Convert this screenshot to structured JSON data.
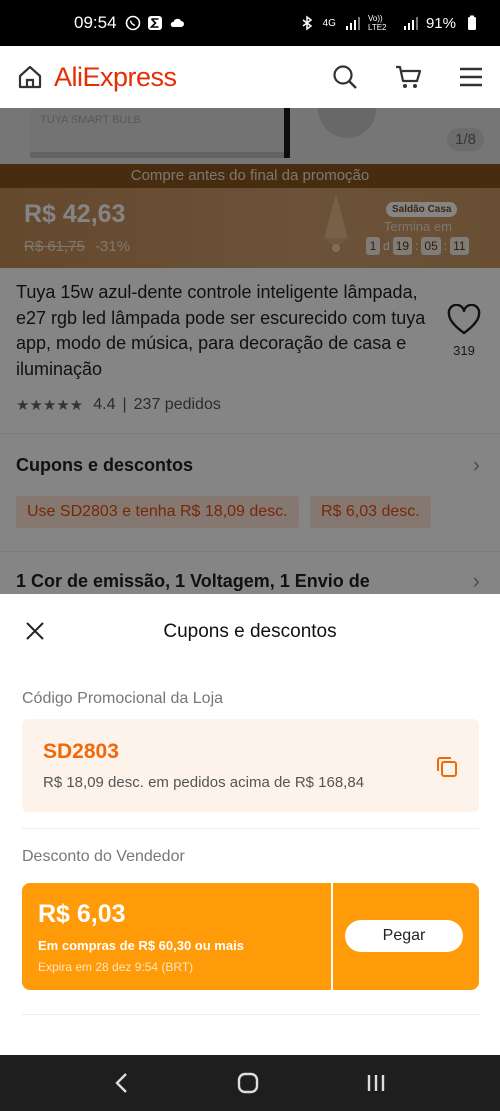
{
  "status_bar": {
    "time": "09:54",
    "network": "4G",
    "volte": "Vo)) LTE2",
    "battery": "91%"
  },
  "header": {
    "logo": "AliExpress"
  },
  "image": {
    "counter": "1/8"
  },
  "promo": {
    "banner": "Compre antes do final da promoção",
    "price": "R$ 42,63",
    "old_price": "R$ 61,75",
    "discount": "-31%",
    "tag": "Saldão Casa",
    "ends_label": "Termina em",
    "days": "1",
    "d": "d",
    "hours": "19",
    "minutes": "05",
    "seconds": "11"
  },
  "product": {
    "title": "Tuya 15w azul-dente controle inteligente lâmpada, e27 rgb led lâmpada pode ser escurecido com tuya app, modo de música, para decoração de casa e iluminação",
    "favorites": "319",
    "rating": "4.4",
    "orders": "237 pedidos",
    "rating_sep": "|"
  },
  "coupons_section": {
    "heading": "Cupons e descontos",
    "chip1": "Use SD2803 e tenha R$ 18,09 desc.",
    "chip2": "R$ 6,03 desc."
  },
  "variants_section": {
    "heading": "1 Cor de emissão, 1 Voltagem, 1 Envio de"
  },
  "sheet": {
    "title": "Cupons e descontos",
    "store_code_label": "Código Promocional da Loja",
    "code": "SD2803",
    "code_desc": "R$ 18,09 desc. em pedidos acima de R$ 168,84",
    "seller_label": "Desconto do Vendedor",
    "coupon_amount": "R$ 6,03",
    "coupon_condition": "Em compras de R$ 60,30 ou mais",
    "coupon_expiry": "Expira em 28 dez 9:54 (BRT)",
    "get_button": "Pegar"
  },
  "colors": {
    "accent": "#e62e04",
    "coupon_orange": "#ff9a08",
    "code_orange": "#f0680a"
  }
}
